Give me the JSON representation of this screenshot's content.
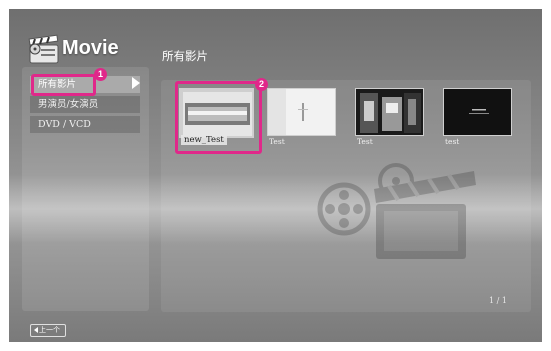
{
  "app": {
    "logo_text": "Movie",
    "logo_icon": "film-clapper-icon"
  },
  "sidebar": {
    "items": [
      {
        "label": "所有影片",
        "active": true
      },
      {
        "label": "男演员/女演员",
        "active": false
      },
      {
        "label": "DVD / VCD",
        "active": false
      }
    ],
    "annotation": "1"
  },
  "main": {
    "title": "所有影片",
    "movies": [
      {
        "label": "new_Test",
        "selected": true
      },
      {
        "label": "Test",
        "selected": false
      },
      {
        "label": "Test",
        "selected": false
      },
      {
        "label": "test",
        "selected": false
      }
    ],
    "annotation": "2",
    "page_indicator": "1 / 1"
  },
  "footer": {
    "back_label": "上一个"
  },
  "colors": {
    "highlight": "#e0288a",
    "text": "#ffffff"
  }
}
